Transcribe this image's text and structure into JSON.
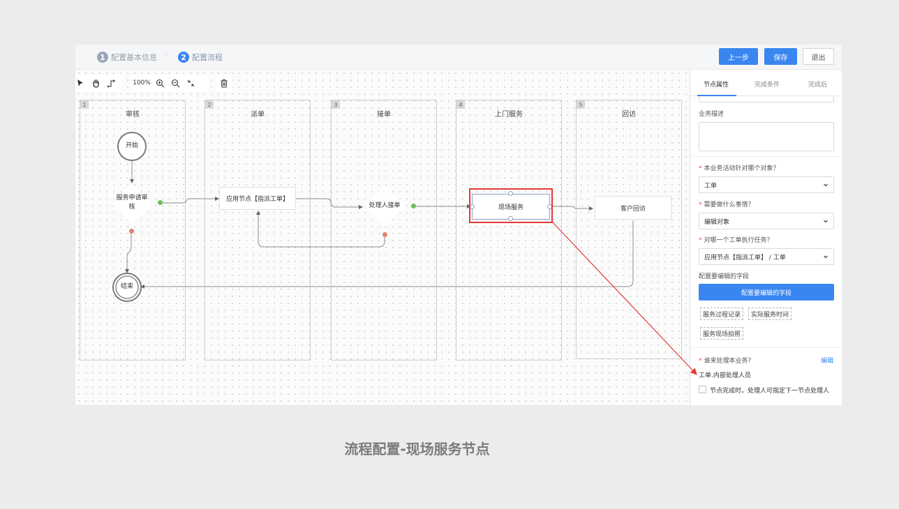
{
  "header": {
    "steps": [
      {
        "num": "1",
        "label": "配置基本信息"
      },
      {
        "num": "2",
        "label": "配置流程"
      }
    ],
    "separator": "···",
    "buttons": {
      "prev": "上一步",
      "save": "保存",
      "exit": "退出"
    }
  },
  "toolbar": {
    "zoom": "100%",
    "icons": [
      "pointer-icon",
      "hand-icon",
      "connector-icon",
      "zoom-in-icon",
      "zoom-out-icon",
      "fit-icon",
      "trash-icon"
    ]
  },
  "lanes": [
    {
      "num": "1",
      "title": "审核"
    },
    {
      "num": "2",
      "title": "派单"
    },
    {
      "num": "3",
      "title": "接单"
    },
    {
      "num": "4",
      "title": "上门服务"
    },
    {
      "num": "5",
      "title": "回访"
    }
  ],
  "nodes": {
    "start": "开始",
    "review": "服务申请审核",
    "review_line1": "服务申请审",
    "review_line2": "核",
    "dispatch": "应用节点【指派工单】",
    "accept": "处理人接单",
    "onsite": "现场服务",
    "revisit": "客户回访",
    "end": "结束"
  },
  "panel": {
    "tabs": [
      "节点属性",
      "完成条件",
      "完成后"
    ],
    "desc_label": "业务描述",
    "q_object": "本业务活动针对哪个对象？",
    "object_value": "工单",
    "q_action": "需要做什么事情？",
    "action_value": "编辑对象",
    "q_task": "对哪一个工单执行任务？",
    "task_value": "应用节点【指派工单】 / 工单",
    "fields_label": "配置要编辑的字段",
    "fields_button": "配置要编辑的字段",
    "chips": [
      "服务过程记录",
      "实际服务时间",
      "服务现场拍照"
    ],
    "q_handler": "谁来处理本业务？",
    "edit_link": "编辑",
    "handler_value": "工单.内部处理人员",
    "checkbox_label": "节点完成时，处理人可指定下一节点处理人"
  },
  "caption": "流程配置-现场服务节点",
  "colors": {
    "accent": "#3a86f0",
    "highlight": "#e53935",
    "port_success": "#6dbf5b",
    "port_fail": "#e0836f"
  }
}
